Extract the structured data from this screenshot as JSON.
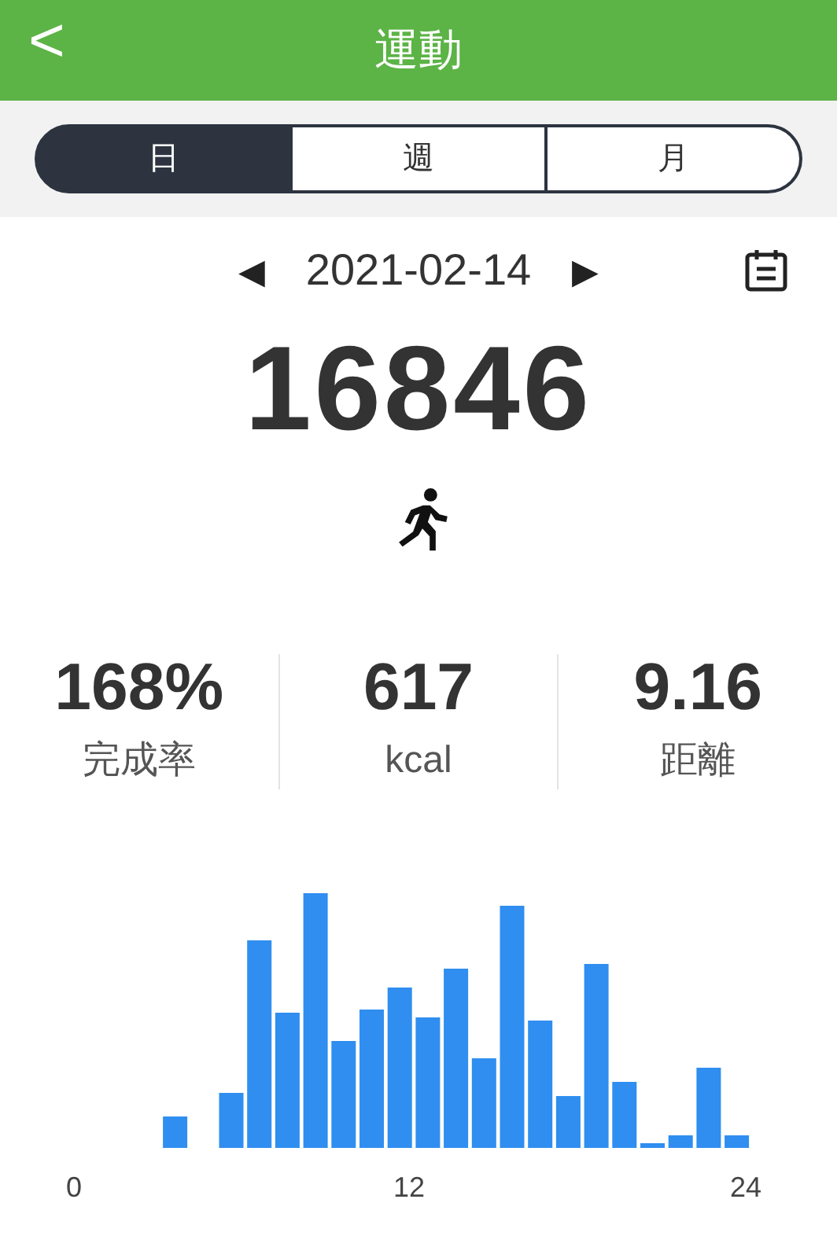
{
  "header": {
    "back": "<",
    "title": "運動"
  },
  "tabs": [
    {
      "label": "日",
      "selected": true
    },
    {
      "label": "週",
      "selected": false
    },
    {
      "label": "月",
      "selected": false
    }
  ],
  "date": {
    "prev": "◀",
    "value": "2021-02-14",
    "next": "▶"
  },
  "steps": "16846",
  "stats": [
    {
      "value": "168%",
      "label": "完成率"
    },
    {
      "value": "617",
      "label": "kcal"
    },
    {
      "value": "9.16",
      "label": "距離"
    }
  ],
  "chart": {
    "x_labels": [
      "0",
      "12",
      "24"
    ]
  }
}
